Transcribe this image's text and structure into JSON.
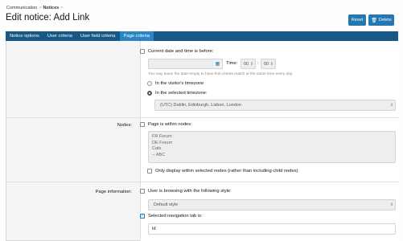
{
  "breadcrumb": {
    "item1": "Communication",
    "item2": "Notices",
    "sep": ">"
  },
  "page": {
    "title": "Edit notice: Add Link"
  },
  "actions": {
    "reset": "Reset",
    "delete": "Delete",
    "delete_icon": "trash-icon"
  },
  "tabs": [
    {
      "label": "Notice options"
    },
    {
      "label": "User criteria"
    },
    {
      "label": "User field criteria"
    },
    {
      "label": "Page criteria"
    }
  ],
  "criteria": {
    "date": {
      "label": "Current date and time is before:",
      "time_label": "Time:",
      "hour": "00",
      "minute": "00",
      "colon": ":",
      "hint": "You may leave the date empty to have this criteria match at the same time every day.",
      "tz_visitor": "In the visitor's timezone",
      "tz_selected": "In the selected timezone:",
      "timezone_value": "(UTC) Dublin, Edinburgh, Lisbon, London"
    },
    "nodes": {
      "section_label": "Nodes:",
      "label": "Page is within nodes:",
      "options": [
        "FR Forum",
        "DE Forum",
        "Cats",
        "-- ABC"
      ],
      "only_selected": "Only display within selected nodes (rather than including child nodes)"
    },
    "page_info": {
      "section_label": "Page information:",
      "style_label": "User is browsing with the following style:",
      "style_value": "Default style",
      "nav_label": "Selected navigation tab is:",
      "nav_value": "Id"
    }
  },
  "colors": {
    "accent": "#2577b1",
    "tabbar": "#185886",
    "tab_active": "#2b85c5"
  }
}
